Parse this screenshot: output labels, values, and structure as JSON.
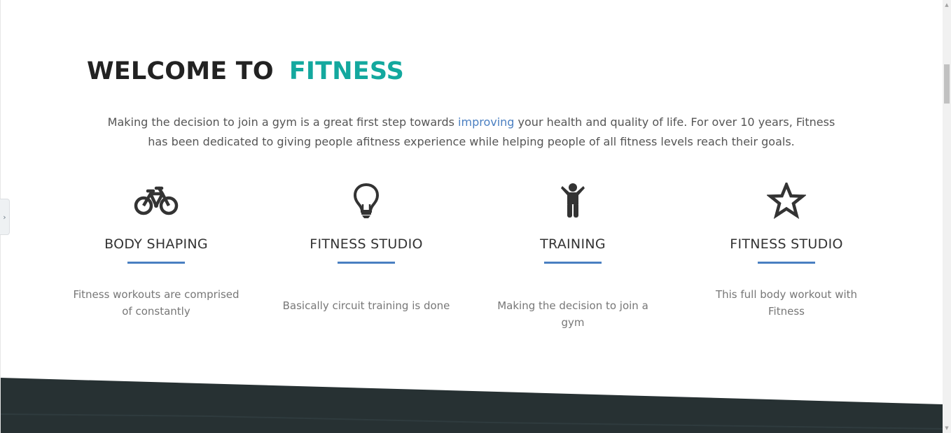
{
  "heading": {
    "part1": "WELCOME TO",
    "part2": "FITNESS"
  },
  "intro": {
    "before_link": "Making the decision to join a gym is a great first step towards ",
    "link": "improving",
    "after_link": " your health and quality of life. For over 10 years, Fitness has been dedicated to giving people afitness experience while helping people of all fitness levels reach their goals."
  },
  "features": [
    {
      "icon": "bicycle-icon",
      "title": "BODY SHAPING",
      "desc": "Fitness workouts are comprised of constantly"
    },
    {
      "icon": "lightbulb-icon",
      "title": "FITNESS STUDIO",
      "desc": "Basically circuit training is done"
    },
    {
      "icon": "child-icon",
      "title": "TRAINING",
      "desc": "Making the decision to join a gym"
    },
    {
      "icon": "star-icon",
      "title": "FITNESS STUDIO",
      "desc": "This full body workout with Fitness"
    }
  ],
  "side_tab": {
    "icon": "chevron-right-icon",
    "glyph": "›"
  },
  "scrollbar": {
    "up_glyph": "▲",
    "down_glyph": "▼"
  },
  "colors": {
    "accent_teal": "#13a89e",
    "accent_blue": "#4a7fc1",
    "band_dark": "#273133",
    "heading_dark": "#222222"
  }
}
